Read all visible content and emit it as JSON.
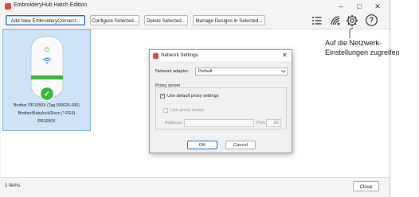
{
  "window": {
    "title": "EmbroideryHub Hatch Edition",
    "controls": {
      "minimize": "–",
      "maximize": "□",
      "close": "✕"
    }
  },
  "toolbar": {
    "add_label": "Add New EmbroideryConnect...",
    "configure_label": "Configure Selected...",
    "delete_label": "Delete Selected...",
    "manage_label": "Manage Designs in Selected...",
    "icons": [
      "list-icon",
      "wifi-settings-icon",
      "gear-icon",
      "help-icon"
    ],
    "help_glyph": "?"
  },
  "device": {
    "line1": "Brother PR1050X (Tag 000026-000)",
    "line2": "Brother/Babylock/Deco (*.PES)",
    "line3": "PR1050X",
    "power_glyph": "⏻",
    "check_glyph": "✓",
    "status_color": "#3cb53c"
  },
  "status": {
    "items_count": "1 items",
    "close_label": "Close"
  },
  "dialog": {
    "title": "Network Settings",
    "close_glyph": "✕",
    "adapter_label": "Network adapter:",
    "adapter_value": "Default",
    "proxy_group": "Proxy server",
    "use_default_label": "Use default proxy settings",
    "use_default_checked": true,
    "use_proxy_label": "Use proxy server",
    "use_proxy_checked": false,
    "address_label": "Address:",
    "address_value": "",
    "port_label": "Port:",
    "port_value": "80",
    "ok_label": "OK",
    "cancel_label": "Cancel"
  },
  "annotation": {
    "line1": "Auf die Netzwerk-",
    "line2": "Einstellungen zugreifen"
  }
}
